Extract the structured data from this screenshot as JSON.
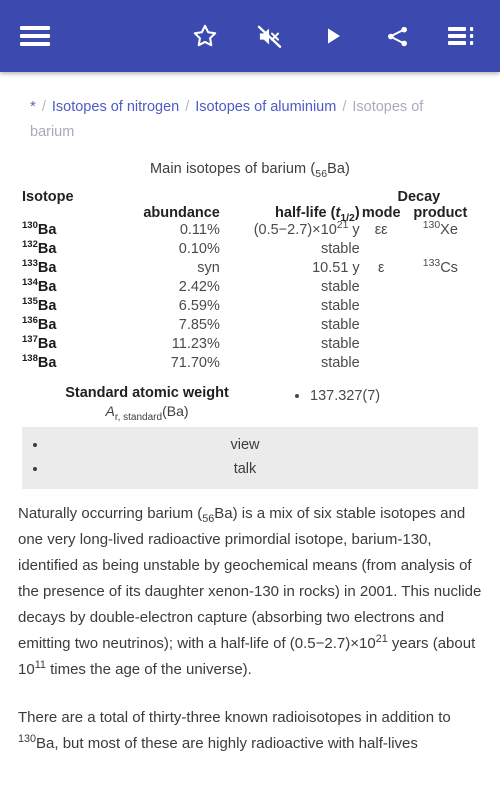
{
  "theme": {
    "toolbar_bg": "#3c4ab0",
    "link_color": "#4b5bc4",
    "muted": "#a7abbc",
    "box_bg": "#ebebeb"
  },
  "toolbar": {
    "menu_icon": "hamburger-menu-icon",
    "actions": [
      {
        "name": "star-icon",
        "label": "Star"
      },
      {
        "name": "mute-icon",
        "label": "Mute"
      },
      {
        "name": "play-icon",
        "label": "Play"
      },
      {
        "name": "share-icon",
        "label": "Share"
      },
      {
        "name": "list-view-icon",
        "label": "Contents"
      }
    ]
  },
  "breadcrumb": {
    "star": "*",
    "separator": "/",
    "items": [
      {
        "label": "Isotopes of nitrogen",
        "current": false
      },
      {
        "label": "Isotopes of aluminium",
        "current": false
      },
      {
        "label": "Isotopes of barium",
        "current": true
      }
    ]
  },
  "infobox": {
    "title_prefix": "Main isotopes of barium (",
    "title_sub": "56",
    "title_suffix": "Ba)",
    "headers": {
      "group_isotope": "Isotope",
      "group_decay": "Decay",
      "abundance": "abundance",
      "half_life": "half-life (",
      "half_life_sym": "t",
      "half_life_sub": "1/2",
      "half_life_close": ")",
      "mode": "mode",
      "product": "product"
    },
    "rows": [
      {
        "mass": "130",
        "element": "Ba",
        "abundance": "0.11%",
        "half_life": "(0.5−2.7)×10",
        "half_life_exp": "21",
        "half_life_unit": " y",
        "mode": "εε",
        "product_mass": "130",
        "product": "Xe"
      },
      {
        "mass": "132",
        "element": "Ba",
        "abundance": "0.10%",
        "half_life": "stable",
        "half_life_exp": "",
        "half_life_unit": "",
        "mode": "",
        "product_mass": "",
        "product": ""
      },
      {
        "mass": "133",
        "element": "Ba",
        "abundance": "syn",
        "half_life": "10.51 y",
        "half_life_exp": "",
        "half_life_unit": "",
        "mode": "ε",
        "product_mass": "133",
        "product": "Cs"
      },
      {
        "mass": "134",
        "element": "Ba",
        "abundance": "2.42%",
        "half_life": "stable",
        "half_life_exp": "",
        "half_life_unit": "",
        "mode": "",
        "product_mass": "",
        "product": ""
      },
      {
        "mass": "135",
        "element": "Ba",
        "abundance": "6.59%",
        "half_life": "stable",
        "half_life_exp": "",
        "half_life_unit": "",
        "mode": "",
        "product_mass": "",
        "product": ""
      },
      {
        "mass": "136",
        "element": "Ba",
        "abundance": "7.85%",
        "half_life": "stable",
        "half_life_exp": "",
        "half_life_unit": "",
        "mode": "",
        "product_mass": "",
        "product": ""
      },
      {
        "mass": "137",
        "element": "Ba",
        "abundance": "11.23%",
        "half_life": "stable",
        "half_life_exp": "",
        "half_life_unit": "",
        "mode": "",
        "product_mass": "",
        "product": ""
      },
      {
        "mass": "138",
        "element": "Ba",
        "abundance": "71.70%",
        "half_life": "stable",
        "half_life_exp": "",
        "half_life_unit": "",
        "mode": "",
        "product_mass": "",
        "product": ""
      }
    ],
    "standard_atomic_weight": {
      "title": "Standard atomic weight",
      "symbol_a": "A",
      "symbol_sub": "r, standard",
      "symbol_arg": "(Ba)",
      "value": "137.327(7)"
    },
    "footer_links": [
      "view",
      "talk"
    ]
  },
  "article": {
    "paragraph_1_part1": "Naturally occurring barium (",
    "paragraph_1_sub": "56",
    "paragraph_1_part2": "Ba) is a mix of six stable isotopes and one very long-lived radioactive primordial isotope, barium-130, identified as being unstable by geochemical means (from analysis of the presence of its daughter xenon-130 in rocks) in 2001. This nuclide decays by double-electron capture (absorbing two electrons and emitting two neutrinos); with a half-life of (0.5−2.7)×10",
    "paragraph_1_exp1": "21",
    "paragraph_1_part3": " years (about 10",
    "paragraph_1_exp2": "11",
    "paragraph_1_part4": " times the age of the universe).",
    "paragraph_2_part1": "There are a total of thirty-three known radioisotopes in addition to ",
    "paragraph_2_sup": "130",
    "paragraph_2_part2": "Ba, but most of these are highly radioactive with half-lives"
  }
}
